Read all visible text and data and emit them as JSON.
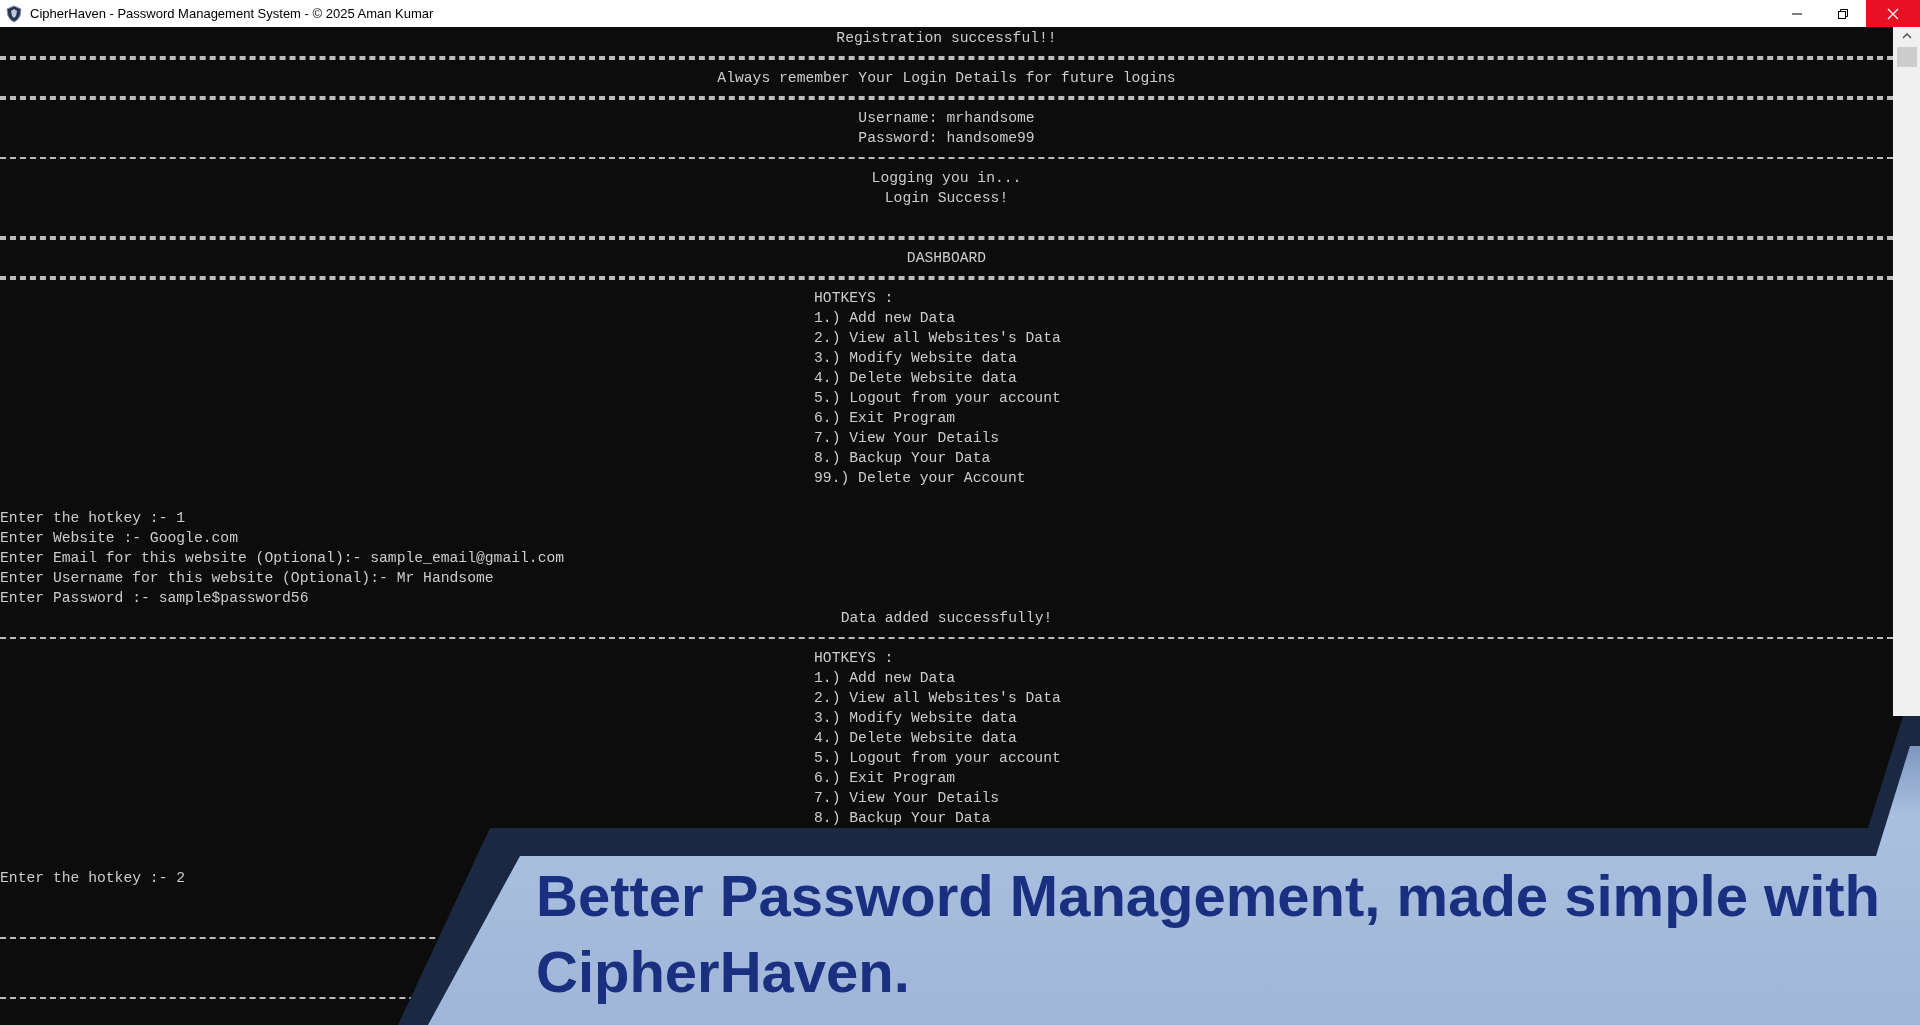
{
  "window": {
    "title": "CipherHaven - Password Management System - © 2025 Aman Kumar"
  },
  "console": {
    "lines": [
      {
        "kind": "center",
        "text": "Registration successful!!"
      },
      {
        "kind": "double-rule"
      },
      {
        "kind": "center",
        "text": "Always remember Your Login Details for future logins"
      },
      {
        "kind": "double-rule"
      },
      {
        "kind": "center",
        "text": "Username: mrhandsome"
      },
      {
        "kind": "center",
        "text": "Password: handsome99"
      },
      {
        "kind": "single-rule"
      },
      {
        "kind": "center",
        "text": "Logging you in..."
      },
      {
        "kind": "center",
        "text": "Login Success!"
      },
      {
        "kind": "blank"
      },
      {
        "kind": "double-rule"
      },
      {
        "kind": "center",
        "text": "DASHBOARD"
      },
      {
        "kind": "double-rule"
      },
      {
        "kind": "menu",
        "text": "HOTKEYS :"
      },
      {
        "kind": "menu",
        "text": "1.) Add new Data"
      },
      {
        "kind": "menu",
        "text": "2.) View all Websites's Data"
      },
      {
        "kind": "menu",
        "text": "3.) Modify Website data"
      },
      {
        "kind": "menu",
        "text": "4.) Delete Website data"
      },
      {
        "kind": "menu",
        "text": "5.) Logout from your account"
      },
      {
        "kind": "menu",
        "text": "6.) Exit Program"
      },
      {
        "kind": "menu",
        "text": "7.) View Your Details"
      },
      {
        "kind": "menu",
        "text": "8.) Backup Your Data"
      },
      {
        "kind": "menu",
        "text": "99.) Delete your Account"
      },
      {
        "kind": "blank"
      },
      {
        "kind": "prompt",
        "text": "Enter the hotkey :- 1"
      },
      {
        "kind": "prompt",
        "text": "Enter Website :- Google.com"
      },
      {
        "kind": "prompt",
        "text": "Enter Email for this website (Optional):- sample_email@gmail.com"
      },
      {
        "kind": "prompt",
        "text": "Enter Username for this website (Optional):- Mr Handsome"
      },
      {
        "kind": "prompt",
        "text": "Enter Password :- sample$password56"
      },
      {
        "kind": "center",
        "text": "Data added successfully!"
      },
      {
        "kind": "single-rule"
      },
      {
        "kind": "menu",
        "text": "HOTKEYS :"
      },
      {
        "kind": "menu",
        "text": "1.) Add new Data"
      },
      {
        "kind": "menu",
        "text": "2.) View all Websites's Data"
      },
      {
        "kind": "menu",
        "text": "3.) Modify Website data"
      },
      {
        "kind": "menu",
        "text": "4.) Delete Website data"
      },
      {
        "kind": "menu",
        "text": "5.) Logout from your account"
      },
      {
        "kind": "menu",
        "text": "6.) Exit Program"
      },
      {
        "kind": "menu",
        "text": "7.) View Your Details"
      },
      {
        "kind": "menu",
        "text": "8.) Backup Your Data"
      },
      {
        "kind": "blank"
      },
      {
        "kind": "blank"
      },
      {
        "kind": "prompt",
        "text": "Enter the hotkey :- 2"
      },
      {
        "kind": "blank"
      },
      {
        "kind": "blank"
      },
      {
        "kind": "single-rule"
      },
      {
        "kind": "blank"
      },
      {
        "kind": "blank"
      },
      {
        "kind": "single-rule"
      }
    ]
  },
  "banner": {
    "text": "Better Password Management, made simple with CipherHaven."
  }
}
